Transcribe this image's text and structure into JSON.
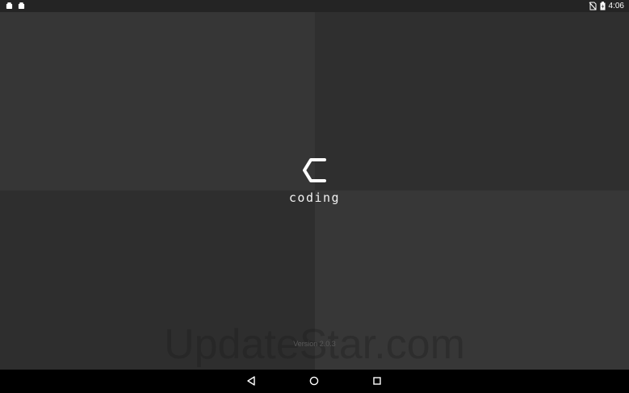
{
  "status_bar": {
    "time": "4:06",
    "left_icons": [
      "android-notification-icon",
      "android-notification-icon"
    ],
    "right_icons": [
      "no-sim-icon",
      "battery-charging-icon"
    ]
  },
  "splash": {
    "logo_icon": "c-logo-icon",
    "app_name": "coding",
    "version": "Version 2.0.3"
  },
  "watermark": "UpdateStar.com",
  "nav_bar": {
    "buttons": [
      "back",
      "home",
      "recents"
    ]
  },
  "colors": {
    "panel_light": "#363636",
    "panel_dark": "#2f2f2f",
    "text": "#f2f2f2",
    "nav_background": "#000000"
  }
}
